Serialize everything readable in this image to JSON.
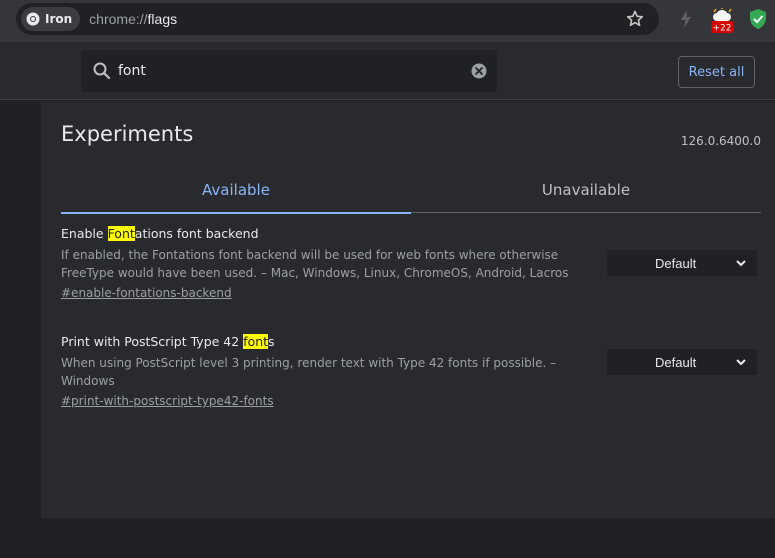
{
  "browser": {
    "chip_label": "Iron",
    "url_scheme": "chrome://",
    "url_path": "flags",
    "icons": [
      "chrome-logo-icon",
      "bookmark-star-icon",
      "extension-lightning-icon",
      "extension-weather-icon",
      "extension-shield-icon"
    ],
    "badge_text": "+22"
  },
  "search": {
    "value": "font",
    "reset_label": "Reset all"
  },
  "page": {
    "title": "Experiments",
    "version": "126.0.6400.0",
    "tabs": [
      {
        "label": "Available",
        "active": true
      },
      {
        "label": "Unavailable",
        "active": false
      }
    ]
  },
  "experiments": [
    {
      "name_pre": "Enable ",
      "name_hl": "Font",
      "name_post": "ations font backend",
      "description": "If enabled, the Fontations font backend will be used for web fonts where otherwise FreeType would have been used. – Mac, Windows, Linux, ChromeOS, Android, Lacros",
      "link": "#enable-fontations-backend",
      "select_value": "Default"
    },
    {
      "name_pre": "Print with PostScript Type 42 ",
      "name_hl": "font",
      "name_post": "s",
      "description": "When using PostScript level 3 printing, render text with Type 42 fonts if possible. – Windows",
      "link": "#print-with-postscript-type42-fonts",
      "select_value": "Default"
    }
  ],
  "colors": {
    "accent": "#8ab4f8",
    "highlight": "#ffff00",
    "background": "#292a2d"
  }
}
